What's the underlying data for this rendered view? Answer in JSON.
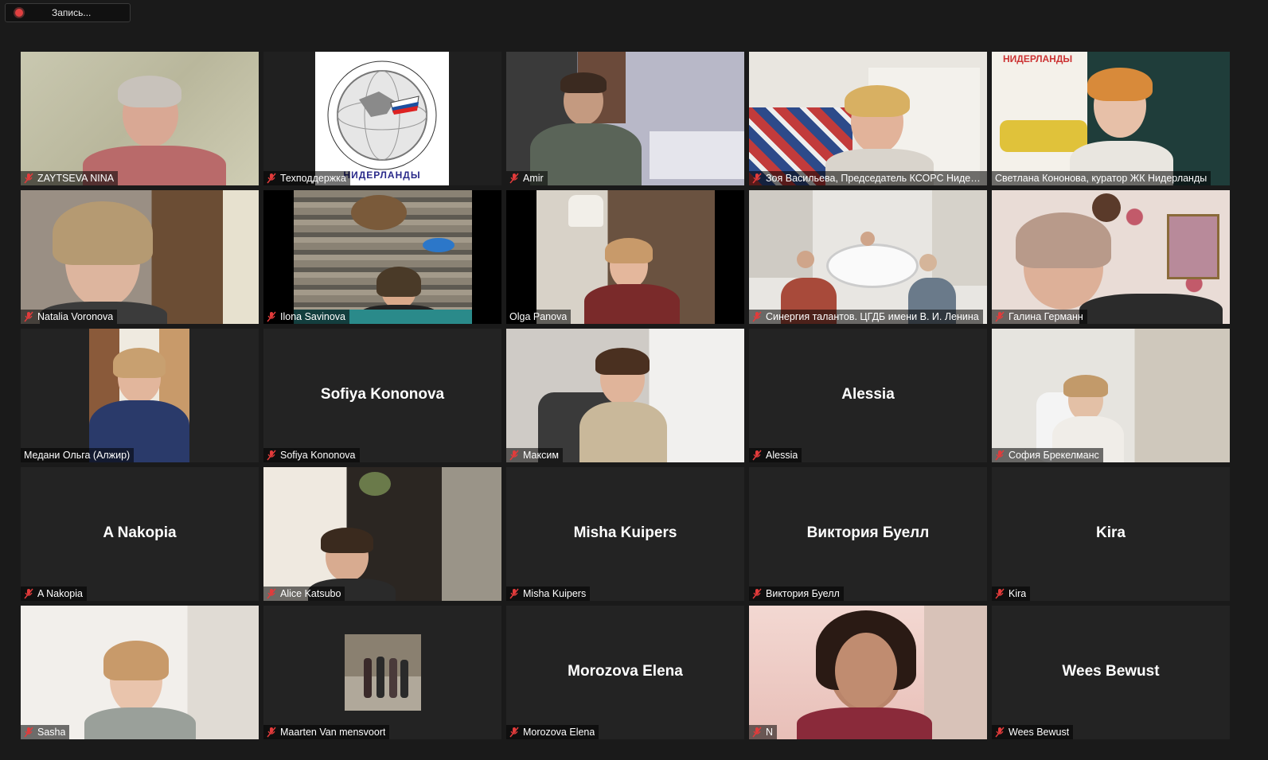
{
  "recording": {
    "label": "Запись..."
  },
  "tiles": [
    {
      "label": "ZAYTSEVA  NINA",
      "muted": true,
      "type": "video"
    },
    {
      "label": "Техподдержка",
      "muted": true,
      "type": "logo",
      "logo_text": "НИДЕРЛАНДЫ"
    },
    {
      "label": "Amir",
      "muted": true,
      "type": "video"
    },
    {
      "label": "Зоя Васильева, Председатель КСОРС Нидер...",
      "muted": true,
      "type": "video"
    },
    {
      "label": "Светлана Кононова, куратор ЖК Нидерланды",
      "muted": false,
      "type": "video",
      "active": true,
      "sign": "НИДЕРЛАНДЫ"
    },
    {
      "label": "Natalia Voronova",
      "muted": true,
      "type": "video"
    },
    {
      "label": "Ilona Savinova",
      "muted": true,
      "type": "video"
    },
    {
      "label": "Olga Panova",
      "muted": false,
      "type": "video"
    },
    {
      "label": "Синергия талантов. ЦГДБ имени В. И. Ленина",
      "muted": true,
      "type": "video"
    },
    {
      "label": "Галина Германн",
      "muted": true,
      "type": "video"
    },
    {
      "label": "Медани Ольга (Алжир)",
      "muted": false,
      "type": "video"
    },
    {
      "label": "Sofiya Kononova",
      "muted": true,
      "type": "name",
      "display_name": "Sofiya Kononova"
    },
    {
      "label": "Максим",
      "muted": true,
      "type": "video"
    },
    {
      "label": "Alessia",
      "muted": true,
      "type": "name",
      "display_name": "Alessia"
    },
    {
      "label": "София Брекелманс",
      "muted": true,
      "type": "video"
    },
    {
      "label": "A Nakopia",
      "muted": true,
      "type": "name",
      "display_name": "A Nakopia"
    },
    {
      "label": "Alice Katsubo",
      "muted": true,
      "type": "video"
    },
    {
      "label": "Misha Kuipers",
      "muted": true,
      "type": "name",
      "display_name": "Misha Kuipers"
    },
    {
      "label": "Виктория Буелл",
      "muted": true,
      "type": "name",
      "display_name": "Виктория Буелл"
    },
    {
      "label": "Kira",
      "muted": true,
      "type": "name",
      "display_name": "Kira"
    },
    {
      "label": "Sasha",
      "muted": true,
      "type": "video"
    },
    {
      "label": "Maarten Van mensvoort",
      "muted": true,
      "type": "video"
    },
    {
      "label": "Morozova Elena",
      "muted": true,
      "type": "name",
      "display_name": "Morozova Elena"
    },
    {
      "label": "N",
      "muted": true,
      "type": "video"
    },
    {
      "label": "Wees Bewust",
      "muted": true,
      "type": "name",
      "display_name": "Wees Bewust"
    }
  ],
  "colors": {
    "accent_active": "#c5e86c",
    "mic_muted": "#e23b3b",
    "tile_bg": "#232323",
    "page_bg": "#1a1a1a"
  }
}
